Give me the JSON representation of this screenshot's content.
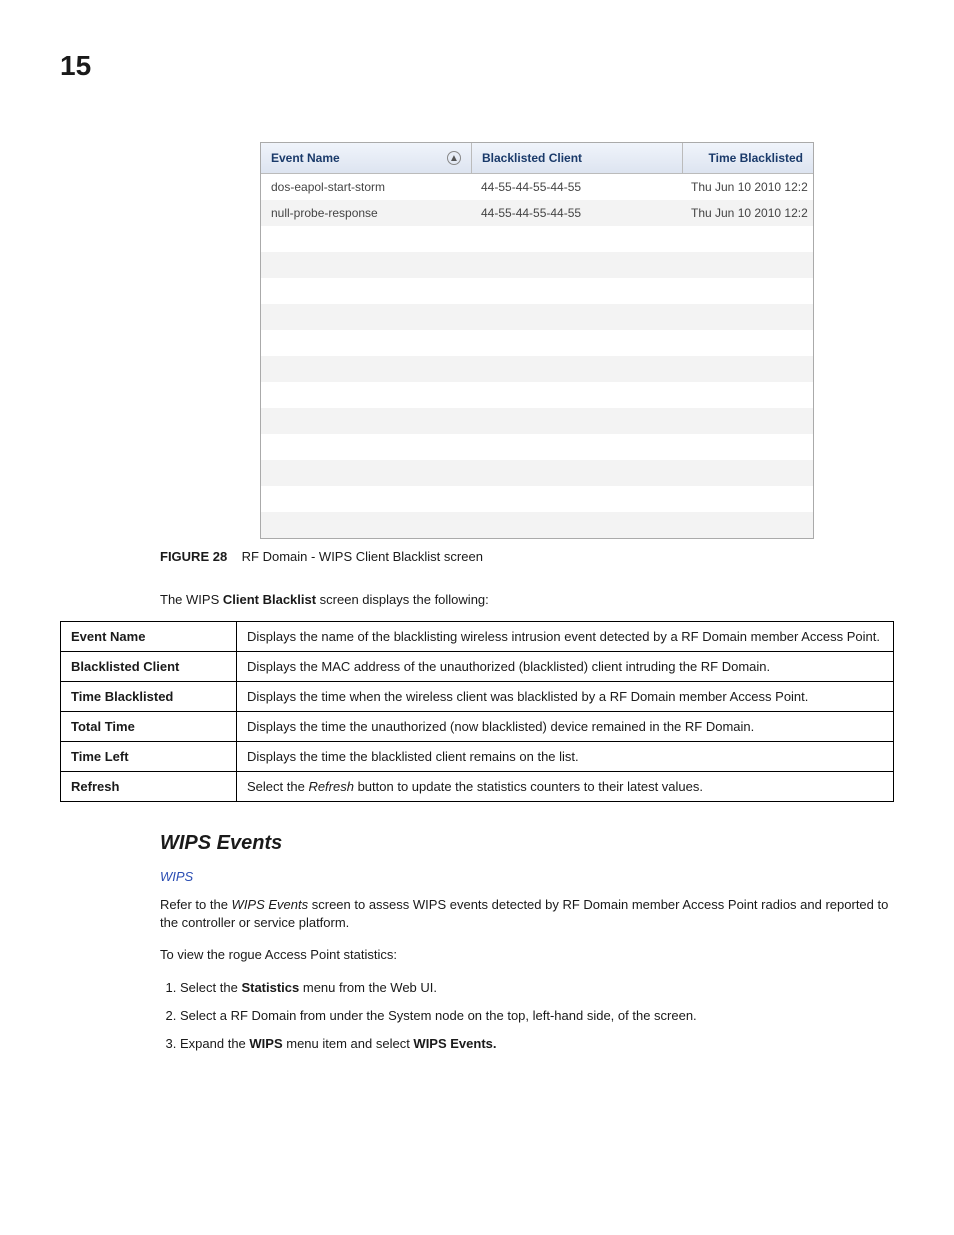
{
  "page_number": "15",
  "screenshot": {
    "headers": {
      "event_name": "Event Name",
      "blacklisted_client": "Blacklisted Client",
      "time_blacklisted": "Time Blacklisted"
    },
    "rows": [
      {
        "event": "dos-eapol-start-storm",
        "client": "44-55-44-55-44-55",
        "time": "Thu Jun 10 2010 12:2"
      },
      {
        "event": "null-probe-response",
        "client": "44-55-44-55-44-55",
        "time": "Thu Jun 10 2010 12:2"
      }
    ],
    "empty_rows": 12
  },
  "figure": {
    "label": "FIGURE 28",
    "caption": "RF Domain - WIPS Client Blacklist screen"
  },
  "intro": {
    "pre": "The WIPS ",
    "bold": "Client Blacklist",
    "post": " screen displays the following:"
  },
  "definitions": [
    {
      "term": "Event Name",
      "desc": "Displays the name of the blacklisting wireless intrusion event detected by a RF Domain member Access Point."
    },
    {
      "term": "Blacklisted Client",
      "desc": "Displays the MAC address of the unauthorized (blacklisted) client intruding the RF Domain."
    },
    {
      "term": "Time Blacklisted",
      "desc": "Displays the time when the wireless client was blacklisted by a RF Domain member Access Point."
    },
    {
      "term": "Total Time",
      "desc": "Displays the time the unauthorized (now blacklisted) device remained in the RF Domain."
    },
    {
      "term": "Time Left",
      "desc": "Displays the time the blacklisted client remains on the list."
    },
    {
      "term": "Refresh",
      "desc_pre": "Select the ",
      "desc_em": "Refresh",
      "desc_post": " button to update the statistics counters to their latest values."
    }
  ],
  "section_title": "WIPS Events",
  "wips_link": "WIPS",
  "section_intro": {
    "pre": "Refer to the ",
    "em": "WIPS Events",
    "post": " screen to assess WIPS events detected by RF Domain member Access Point radios and reported to the controller or service platform."
  },
  "steps_intro": "To view the rogue Access Point statistics:",
  "steps": {
    "s1_pre": "Select the ",
    "s1_b": "Statistics",
    "s1_post": " menu from the Web UI.",
    "s2": "Select a RF Domain from under the System node on the top, left-hand side, of the screen.",
    "s3_pre": "Expand the ",
    "s3_b1": "WIPS",
    "s3_mid": " menu item and select ",
    "s3_b2": "WIPS Events."
  }
}
